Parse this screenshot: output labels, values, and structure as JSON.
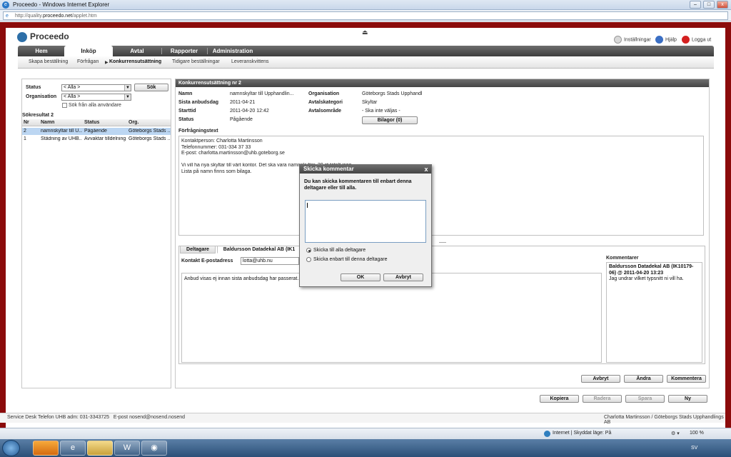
{
  "browser": {
    "title": "Proceedo - Windows Internet Explorer",
    "url_prefix": "http://quality.",
    "url_domain": "proceedo.net",
    "url_suffix": "/applet.htm",
    "status_zone": "Internet | Skyddat läge: På",
    "zoom": "100 %"
  },
  "header": {
    "brand": "Proceedo",
    "links": [
      {
        "label": "Inställningar",
        "icon": "settings-icon"
      },
      {
        "label": "Hjälp",
        "icon": "help-icon"
      },
      {
        "label": "Logga ut",
        "icon": "logout-icon"
      }
    ]
  },
  "nav": {
    "tabs": [
      "Hem",
      "Inköp",
      "Avtal",
      "Rapporter",
      "Administration"
    ],
    "active": "Inköp",
    "subnav": [
      "Skapa beställning",
      "Förfrågan",
      "Konkurrensutsättning",
      "Tidigare beställningar",
      "Leveranskvittens"
    ],
    "subnav_active": "Konkurrensutsättning"
  },
  "search": {
    "status_label": "Status",
    "status_value": "< Alla >",
    "org_label": "Organisation",
    "org_value": "< Alla >",
    "search_button": "Sök",
    "checkbox_label": "Sök från alla användare",
    "results_title": "Sökresultat 2",
    "columns": [
      "Nr",
      "Namn",
      "Status",
      "Org."
    ],
    "rows": [
      {
        "nr": "2",
        "name": "namnskyltar till U...",
        "status": "Pågående",
        "org": "Göteborgs Stads ..."
      },
      {
        "nr": "1",
        "name": "Städning av UHB...",
        "status": "Avvaktar tilldelning",
        "org": "Göteborgs Stads ..."
      }
    ]
  },
  "detail": {
    "title": "Konkurrensutsättning nr 2",
    "fields": {
      "name_label": "Namn",
      "name_value": "namnskyltar till Upphandlin...",
      "deadline_label": "Sista anbudsdag",
      "deadline_value": "2011-04-21",
      "start_label": "Starttid",
      "start_value": "2011-04-20 12:42",
      "status_label": "Status",
      "status_value": "Pågående",
      "org_label": "Organisation",
      "org_value": "Göteborgs Stads Upphandl",
      "category_label": "Avtalskategori",
      "category_value": "Skyltar",
      "area_label": "Avtalsområde",
      "area_value": "- Ska inte väljas -",
      "attachments_button": "Bilagor (0)"
    },
    "inquiry_label": "Förfrågningstext",
    "inquiry_lines": [
      "Kontaktperson: Charlotta Martinsson",
      "Telefonnummer: 031-334 37 33",
      "E-post: charlotta.martinsson@uhb.goteborg.se",
      "",
      "Vi vill ha nya skyltar till vårt kontor. Det ska vara namnskyltar, 20 st totalt ieoo",
      "Lista på namn finns som bilaga."
    ],
    "tabs": [
      "Deltagare",
      "Baldursson Datadekal AB (IK1"
    ],
    "contact_label": "Kontakt E-postadress",
    "contact_value": "lotta@uhb.nu",
    "message": "Anbud visas ej innan sista anbudsdag har passerat.",
    "comments_label": "Kommentarer",
    "comment_author": "Baldursson Datadekal AB (IK10179-06) @ 2011-04-20 13:23",
    "comment_text": "Jag undrar vilket typsnitt ni vill ha.",
    "actions": [
      "Avbryt",
      "Ändra",
      "Kommentera"
    ],
    "footer_actions": [
      "Kopiera",
      "Radera",
      "Spara",
      "Ny"
    ]
  },
  "dialog": {
    "title": "Skicka kommentar",
    "close": "x",
    "text": "Du kan skicka kommentaren till enbart denna deltagare eller till alla.",
    "textarea_value": "",
    "option_all": "Skicka till alla deltagare",
    "option_one": "Skicka enbart till denna deltagare",
    "ok": "OK",
    "cancel": "Avbryt"
  },
  "footer": {
    "left": "Service Desk Telefon UHB adm: 031-3343725   E-post nosend@nosend.nosend",
    "right": "Charlotta Martinsson / Göteborgs Stads Upphandlings AB"
  },
  "taskbar": {
    "lang": "SV"
  }
}
